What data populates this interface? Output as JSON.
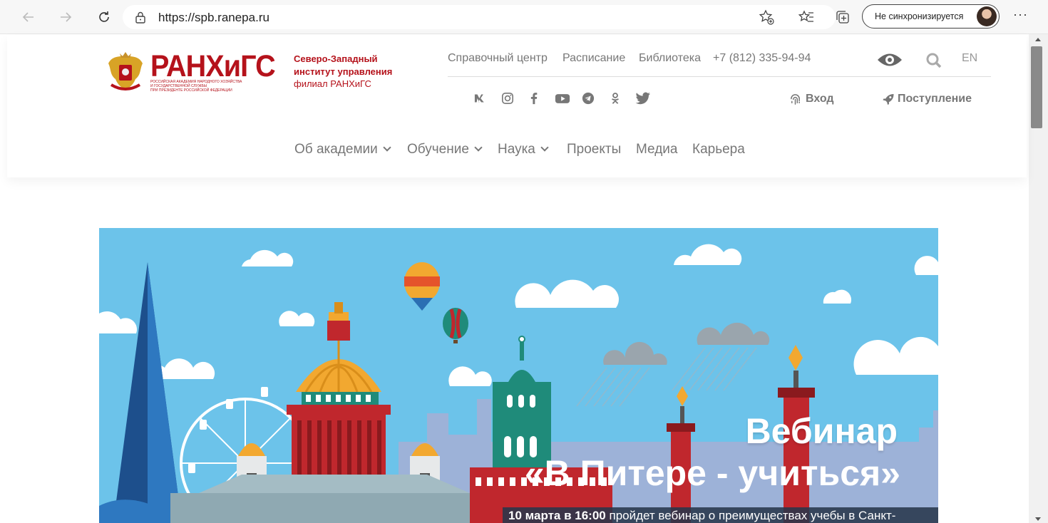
{
  "browser": {
    "url": "https://spb.ranepa.ru",
    "sync_label": "Не синхронизируется",
    "more_label": "···"
  },
  "site": {
    "brand": "РАНХиГС",
    "brand_sub": [
      "РОССИЙСКАЯ АКАДЕМИЯ НАРОДНОГО ХОЗЯЙСТВА",
      "И ГОСУДАРСТВЕННОЙ СЛУЖБЫ",
      "ПРИ ПРЕЗИДЕНТЕ РОССИЙСКОЙ ФЕДЕРАЦИИ"
    ],
    "institute": [
      "Северо-Западный",
      "институт управления",
      "филиал РАНХиГС"
    ],
    "top_links": [
      "Справочный центр",
      "Расписание",
      "Библиотека",
      "+7 (812) 335-94-94"
    ],
    "lang": "EN",
    "social": [
      "vk-icon",
      "instagram-icon",
      "facebook-icon",
      "youtube-icon",
      "telegram-icon",
      "odnoklassniki-icon",
      "twitter-icon"
    ],
    "login": "Вход",
    "admission": "Поступление",
    "menu": [
      {
        "label": "Об академии",
        "has_dropdown": true
      },
      {
        "label": "Обучение",
        "has_dropdown": true
      },
      {
        "label": "Наука",
        "has_dropdown": true
      },
      {
        "label": "Проекты",
        "has_dropdown": false
      },
      {
        "label": "Медиа",
        "has_dropdown": false
      },
      {
        "label": "Карьера",
        "has_dropdown": false
      }
    ]
  },
  "banner": {
    "title": "Вебинар",
    "subtitle": "«В Питере - учиться»",
    "text_bold": "10 марта в 16:00",
    "text": " пройдет вебинар о преимуществах учебы в Санкт-",
    "colors": {
      "sky": "#6cc3ea",
      "red": "#c0272d",
      "gold": "#f2a830",
      "teal": "#1f8b7a",
      "navy": "#1d4f8c"
    }
  }
}
